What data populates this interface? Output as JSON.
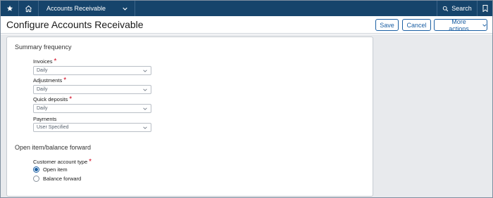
{
  "topbar": {
    "module_label": "Accounts Receivable",
    "search_label": "Search",
    "background": "#16446b"
  },
  "header": {
    "title": "Configure Accounts Receivable",
    "save_label": "Save",
    "cancel_label": "Cancel",
    "more_actions_label": "More actions",
    "accent": "#1b5fa3"
  },
  "summary_frequency": {
    "title": "Summary frequency",
    "fields": [
      {
        "label": "Invoices",
        "required": true,
        "value": "Daily"
      },
      {
        "label": "Adjustments",
        "required": true,
        "value": "Daily"
      },
      {
        "label": "Quick deposits",
        "required": true,
        "value": "Daily"
      },
      {
        "label": "Payments",
        "required": false,
        "value": "User Specified"
      }
    ]
  },
  "open_item": {
    "title": "Open item/balance forward",
    "customer_account_type_label": "Customer account type",
    "options": [
      {
        "label": "Open item",
        "selected": true
      },
      {
        "label": "Balance forward",
        "selected": false
      }
    ]
  },
  "required_marker": "*"
}
